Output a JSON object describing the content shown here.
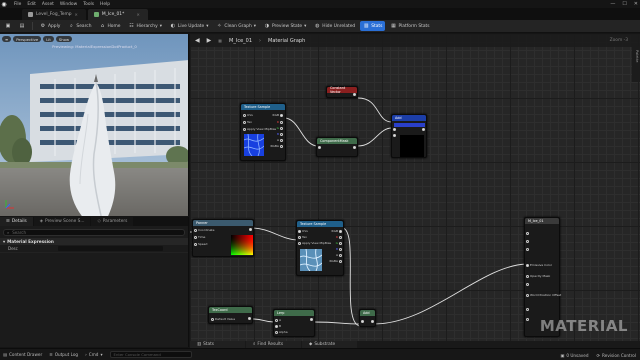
{
  "menu": {
    "items": [
      "File",
      "Edit",
      "Asset",
      "Window",
      "Tools",
      "Help"
    ]
  },
  "tabs": [
    {
      "label": "Level_Fog_Temp",
      "active": false
    },
    {
      "label": "M_Ice_01*",
      "active": true
    }
  ],
  "toolbar": {
    "buttons": [
      "Apply",
      "Search",
      "Home",
      "Hierarchy",
      "Live Update",
      "Clean Graph",
      "Preview State",
      "Hide Unrelated",
      "Stats",
      "Platform Stats"
    ]
  },
  "viewport": {
    "buttons": [
      "Perspective",
      "Lit",
      "Show"
    ],
    "label": "Previewing: MaterialExpressionDotProduct_0"
  },
  "details": {
    "tabs": [
      "Details",
      "Preview Scene S...",
      "Parameters"
    ],
    "search_placeholder": "Search",
    "section": "Material Expression",
    "row_label": "Desc"
  },
  "graph": {
    "breadcrumb": "M_Ice_01",
    "breadcrumb_tail": "Material Graph",
    "zoom": "Zoom -3",
    "palette": "Palette",
    "watermark": "MATERIAL",
    "nodes": {
      "texsample_top": {
        "title": "Texture Sample",
        "pins": [
          "UVs",
          "Tex",
          "Apply View MipBias",
          "RGB",
          "R",
          "G",
          "B",
          "A",
          "RGBA"
        ]
      },
      "constant_top": {
        "title": "Constant Vector"
      },
      "multiply_top": {
        "title": "ComponentMask"
      },
      "vector_node": {
        "title": "Add"
      },
      "panner": {
        "title": "Panner",
        "pins": [
          "Coordinate",
          "Time",
          "Speed"
        ]
      },
      "texsample_bottom": {
        "title": "Texture Sample",
        "pins": [
          "UVs",
          "Tex",
          "Apply View MipBias",
          "RGB",
          "R",
          "G",
          "B",
          "A",
          "RGBA"
        ]
      },
      "texcoord": {
        "title": "TexCoord",
        "pins": [
          "Default Value"
        ]
      },
      "lerp": {
        "title": "Lerp",
        "pins": [
          "A",
          "B",
          "Alpha"
        ]
      },
      "add_small": {
        "title": "Add"
      },
      "material_output": {
        "title": "M_Ice_01",
        "pins": [
          "Emissive Color",
          "Opacity Mask",
          "World Position Offset"
        ]
      }
    }
  },
  "graph_tabs": [
    "Stats",
    "Find Results",
    "Substrate"
  ],
  "statusbar": {
    "left": [
      "Content Drawer",
      "Output Log",
      "Cmd"
    ],
    "cmd_placeholder": "Enter Console Command",
    "right": [
      "0 Unsaved",
      "Revision Control"
    ]
  },
  "colors": {
    "accent": "#2a6fd6",
    "texture_header": "#1f5f8a",
    "constant_header": "#8a1f1f",
    "math_header": "#3f6b4a",
    "output_header": "#3a3a3a"
  }
}
